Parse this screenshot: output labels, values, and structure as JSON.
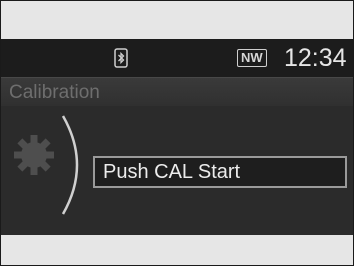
{
  "status_bar": {
    "bluetooth_icon": "bluetooth-phone-icon",
    "mode_badge": "NW",
    "clock": "12:34"
  },
  "screen": {
    "title": "Calibration",
    "settings_icon": "gear-icon",
    "action_button_label": "Push CAL Start"
  }
}
